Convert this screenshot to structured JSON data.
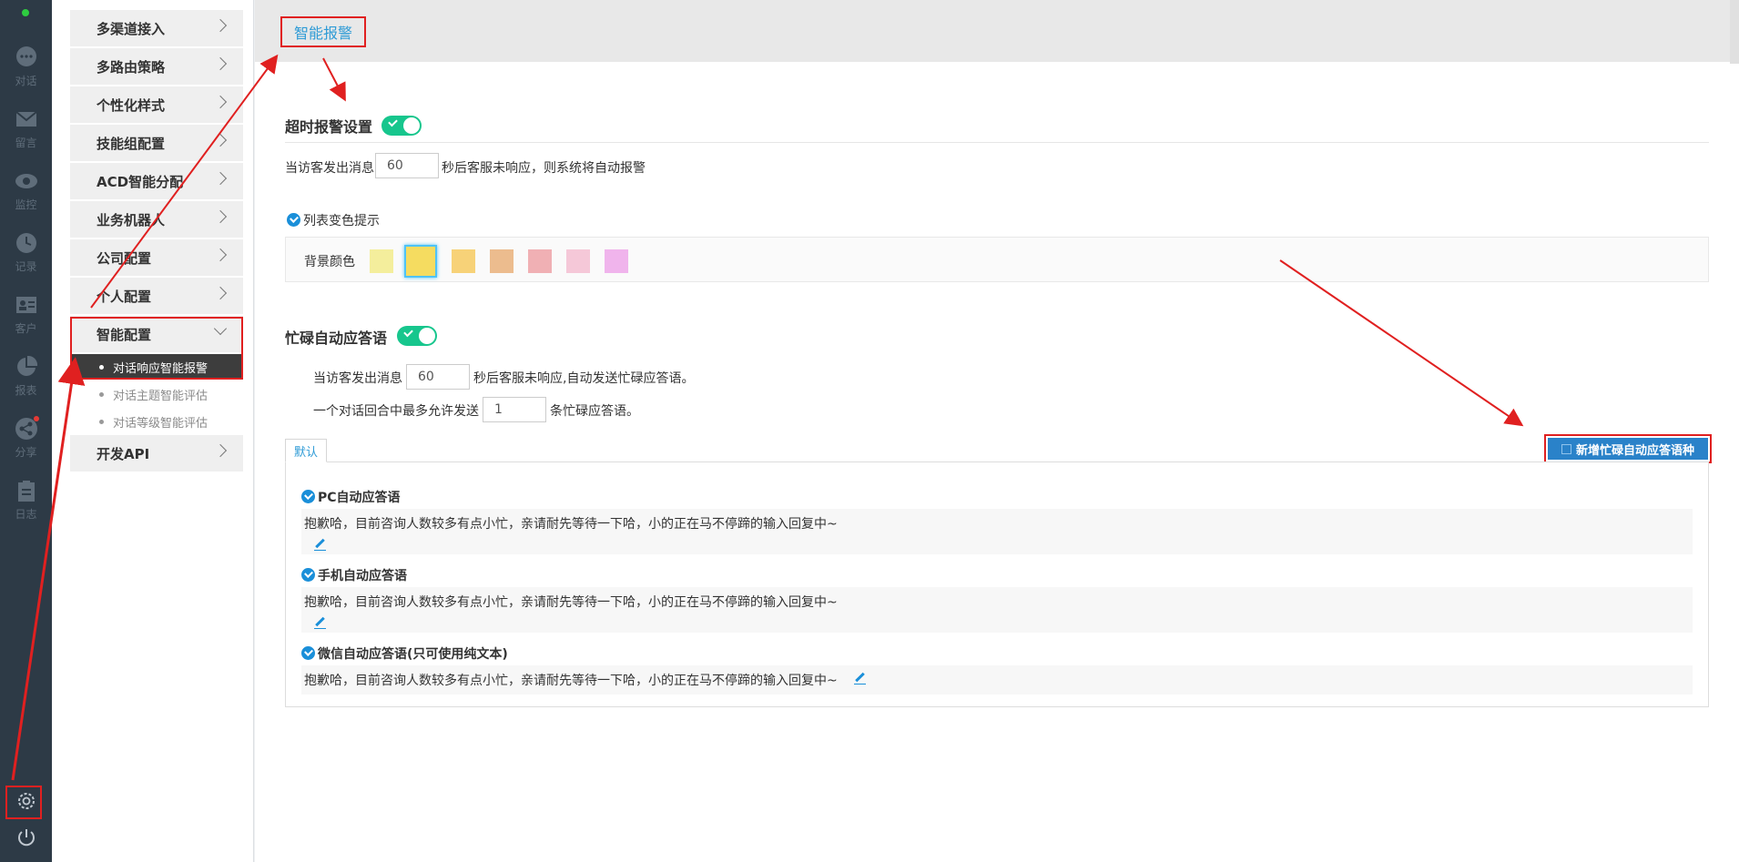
{
  "rail": {
    "items": [
      {
        "icon": "chat-icon",
        "label": "对话"
      },
      {
        "icon": "mail-icon",
        "label": "留言"
      },
      {
        "icon": "eye-icon",
        "label": "监控"
      },
      {
        "icon": "clock-icon",
        "label": "记录"
      },
      {
        "icon": "contact-card-icon",
        "label": "客户"
      },
      {
        "icon": "pie-chart-icon",
        "label": "报表"
      },
      {
        "icon": "share-icon",
        "label": "分享"
      },
      {
        "icon": "clipboard-icon",
        "label": "日志"
      }
    ],
    "bottom_icons": [
      "gear-icon",
      "power-icon"
    ]
  },
  "menu": {
    "items": [
      {
        "label": "多渠道接入"
      },
      {
        "label": "多路由策略"
      },
      {
        "label": "个性化样式"
      },
      {
        "label": "技能组配置"
      },
      {
        "label": "ACD智能分配"
      },
      {
        "label": "业务机器人"
      },
      {
        "label": "公司配置"
      },
      {
        "label": "个人配置"
      },
      {
        "label": "智能配置"
      }
    ],
    "sub_items": [
      {
        "label": "对话响应智能报警"
      },
      {
        "label": "对话主题智能评估"
      },
      {
        "label": "对话等级智能评估"
      }
    ],
    "last_item": {
      "label": "开发API"
    }
  },
  "header": {
    "title": "智能报警"
  },
  "timeout_alarm": {
    "title": "超时报警设置",
    "enabled": true,
    "prefix": "当访客发出消息",
    "seconds": "60",
    "suffix": "秒后客服未响应，则系统将自动报警",
    "list_color_label": "列表变色提示",
    "bg_color_label": "背景颜色",
    "colors": [
      "#f4ee9c",
      "#f5dc60",
      "#f7d278",
      "#ecbc8e",
      "#f0b0b4",
      "#f5c8d8",
      "#f0b4ec"
    ],
    "selected_color_index": 1
  },
  "busy_reply": {
    "title": "忙碌自动应答语",
    "enabled": true,
    "line1_prefix": "当访客发出消息",
    "line1_seconds": "60",
    "line1_suffix": "秒后客服未响应,自动发送忙碌应答语。",
    "line2_prefix": "一个对话回合中最多允许发送",
    "line2_count": "1",
    "line2_suffix": "条忙碌应答语。",
    "tab_label": "默认",
    "add_button_label": "新增忙碌自动应答语种",
    "replies": [
      {
        "label": "PC自动应答语",
        "text": "抱歉哈，目前咨询人数较多有点小忙，亲请耐先等待一下哈，小的正在马不停蹄的输入回复中~"
      },
      {
        "label": "手机自动应答语",
        "text": "抱歉哈，目前咨询人数较多有点小忙，亲请耐先等待一下哈，小的正在马不停蹄的输入回复中~"
      },
      {
        "label": "微信自动应答语(只可使用纯文本)",
        "text": "抱歉哈，目前咨询人数较多有点小忙，亲请耐先等待一下哈，小的正在马不停蹄的输入回复中~"
      }
    ]
  }
}
